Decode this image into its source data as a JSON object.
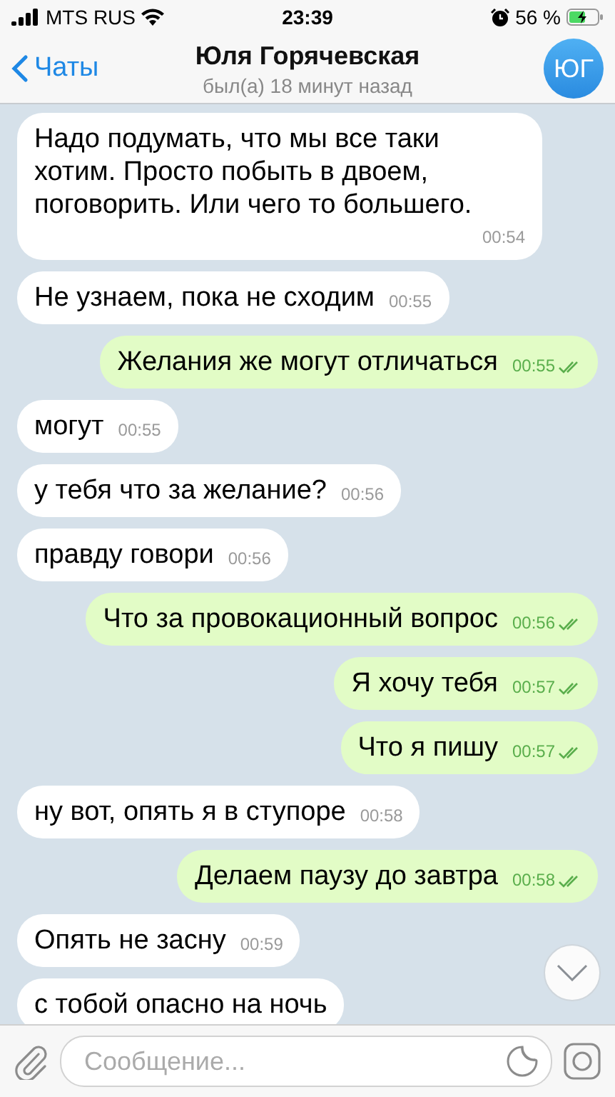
{
  "status_bar": {
    "carrier": "MTS RUS",
    "time": "23:39",
    "battery": "56 %"
  },
  "header": {
    "back": "Чаты",
    "title": "Юля Горячевская",
    "subtitle": "был(а) 18 минут назад",
    "avatar": "ЮГ"
  },
  "messages": [
    {
      "kind": "incoming",
      "text": "Надо подумать, что мы все таки хотим. Просто побыть в двоем, поговорить. Или чего то большего.",
      "time": "00:54"
    },
    {
      "kind": "incoming",
      "text": "Не узнаем, пока не сходим",
      "time": "00:55"
    },
    {
      "kind": "outgoing",
      "text": "Желания же могут отличаться",
      "time": "00:55",
      "read": true
    },
    {
      "kind": "incoming",
      "text": "могут",
      "time": "00:55"
    },
    {
      "kind": "incoming",
      "text": "у тебя что за желание?",
      "time": "00:56"
    },
    {
      "kind": "incoming",
      "text": "правду говори",
      "time": "00:56"
    },
    {
      "kind": "outgoing",
      "text": "Что за провокационный вопрос",
      "time": "00:56",
      "read": true
    },
    {
      "kind": "outgoing",
      "text": "Я хочу тебя",
      "time": "00:57",
      "read": true
    },
    {
      "kind": "outgoing",
      "text": "Что я пишу",
      "time": "00:57",
      "read": true
    },
    {
      "kind": "incoming",
      "text": "ну вот, опять я в ступоре",
      "time": "00:58"
    },
    {
      "kind": "outgoing",
      "text": "Делаем паузу до завтра",
      "time": "00:58",
      "read": true
    },
    {
      "kind": "incoming",
      "text": "Опять не засну",
      "time": "00:59"
    },
    {
      "kind": "incoming",
      "text": "с тобой опасно на ночь"
    }
  ],
  "composer": {
    "placeholder": "Сообщение..."
  }
}
